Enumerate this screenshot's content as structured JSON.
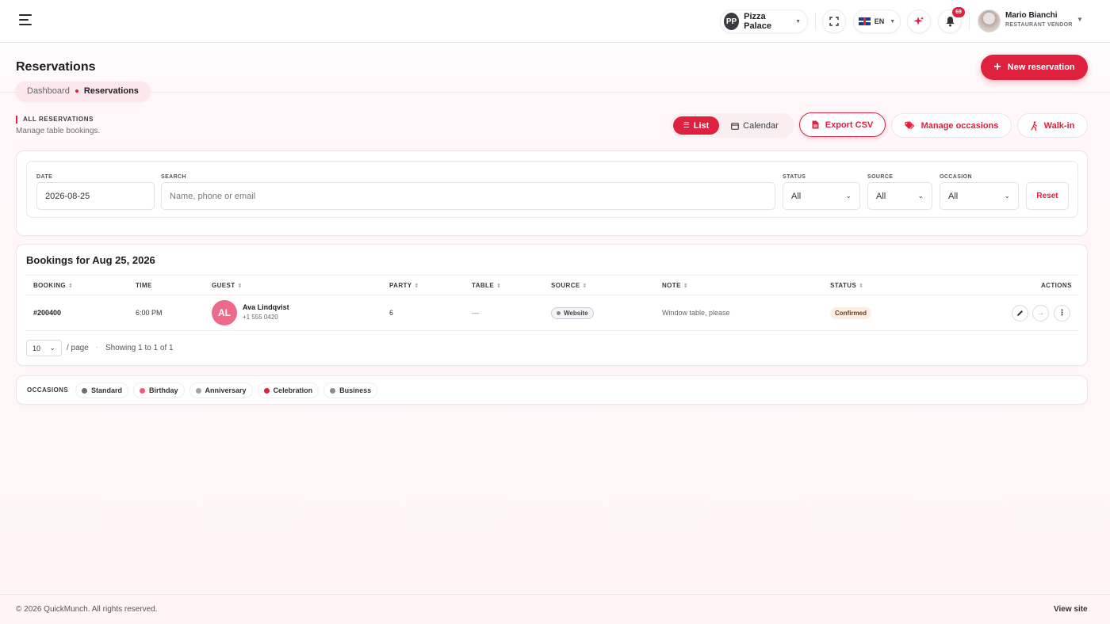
{
  "topbar": {
    "store": {
      "initials": "PP",
      "name": "Pizza Palace"
    },
    "language": "EN",
    "notifications_count": "69",
    "user": {
      "name": "Mario Bianchi",
      "role": "RESTAURANT VENDOR"
    }
  },
  "page": {
    "title": "Reservations",
    "new_button": "New reservation",
    "breadcrumb": {
      "parent": "Dashboard",
      "current": "Reservations"
    }
  },
  "section": {
    "label": "ALL RESERVATIONS",
    "subtitle": "Manage table bookings."
  },
  "toolbar": {
    "view_list": "List",
    "view_calendar": "Calendar",
    "export": "Export CSV",
    "manage_occasions": "Manage occasions",
    "walk_in": "Walk-in"
  },
  "filters": {
    "date": {
      "label": "DATE",
      "value": "2026-08-25"
    },
    "search": {
      "label": "SEARCH",
      "placeholder": "Name, phone or email"
    },
    "status": {
      "label": "STATUS",
      "value": "All"
    },
    "source": {
      "label": "SOURCE",
      "value": "All"
    },
    "occasion": {
      "label": "OCCASION",
      "value": "All"
    },
    "reset": "Reset"
  },
  "bookings": {
    "title": "Bookings for Aug 25, 2026",
    "columns": [
      "BOOKING",
      "TIME",
      "GUEST",
      "PARTY",
      "TABLE",
      "SOURCE",
      "NOTE",
      "STATUS",
      "ACTIONS"
    ],
    "rows": [
      {
        "booking": "#200400",
        "time": "6:00 PM",
        "guest_initials": "AL",
        "guest_name": "Ava Lindqvist",
        "guest_phone": "+1 555 0420",
        "party": "6",
        "table": "—",
        "source": "Website",
        "note": "Window table, please",
        "status": "Confirmed"
      }
    ],
    "page_size": "10",
    "per_page_label": "/ page",
    "separator": "·",
    "showing": "Showing 1 to 1 of 1"
  },
  "occasions": {
    "label": "OCCASIONS",
    "items": [
      {
        "name": "Standard",
        "color": "#6b6b73"
      },
      {
        "name": "Birthday",
        "color": "#ec5b7f"
      },
      {
        "name": "Anniversary",
        "color": "#a4a4aa"
      },
      {
        "name": "Celebration",
        "color": "#e0203f"
      },
      {
        "name": "Business",
        "color": "#8a8a92"
      }
    ]
  },
  "footer": {
    "copyright": "© 2026 QuickMunch. All rights reserved.",
    "view_site": "View site"
  },
  "colors": {
    "accent": "#e0203f",
    "accent_soft": "#fbe7ec"
  }
}
